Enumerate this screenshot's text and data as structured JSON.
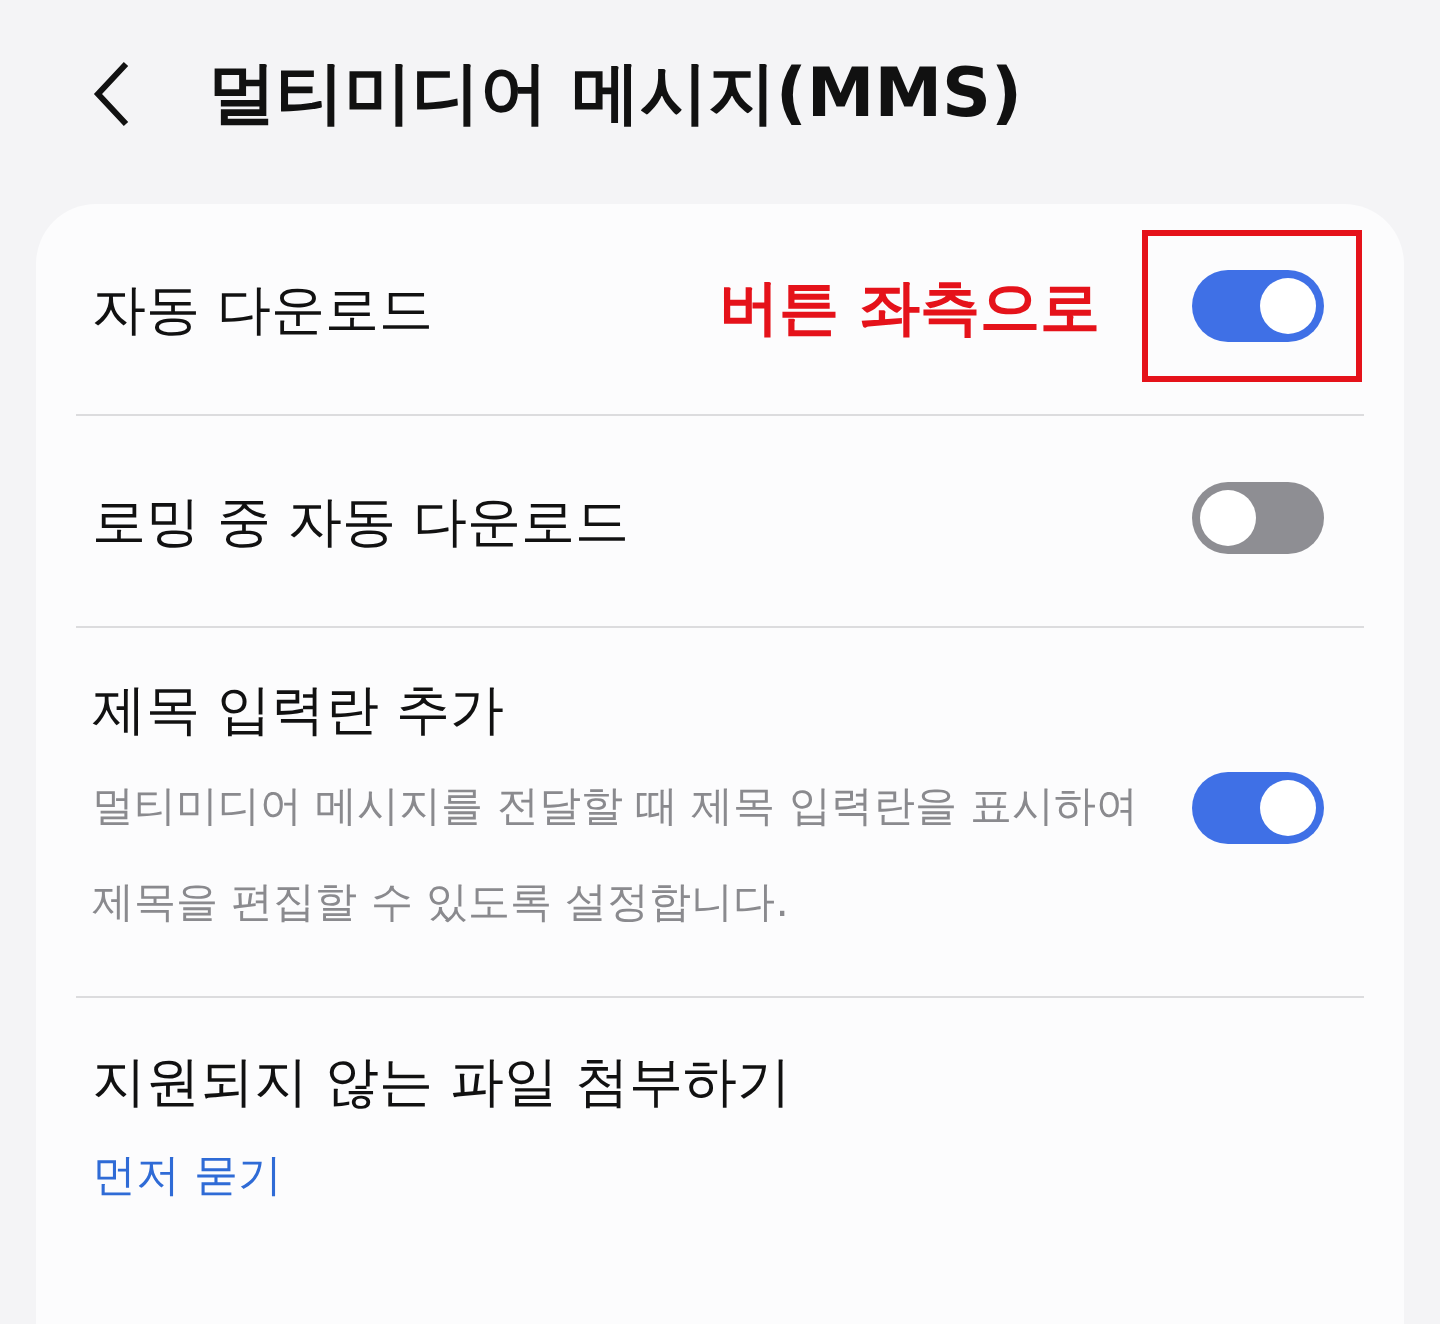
{
  "header": {
    "title": "멀티미디어 메시지(MMS)"
  },
  "settings": [
    {
      "kind": "toggle",
      "title": "자동 다운로드",
      "on": true,
      "highlighted": true,
      "annotation": "버튼 좌측으로"
    },
    {
      "kind": "toggle",
      "title": "로밍 중 자동 다운로드",
      "on": false,
      "highlighted": false
    },
    {
      "kind": "toggle",
      "title": "제목 입력란 추가",
      "description": "멀티미디어 메시지를 전달할 때 제목 입력란을 표시하여 제목을 편집할 수 있도록 설정합니다.",
      "on": true,
      "highlighted": false
    },
    {
      "kind": "link",
      "title": "지원되지 않는 파일 첨부하기",
      "value": "먼저 묻기"
    }
  ]
}
